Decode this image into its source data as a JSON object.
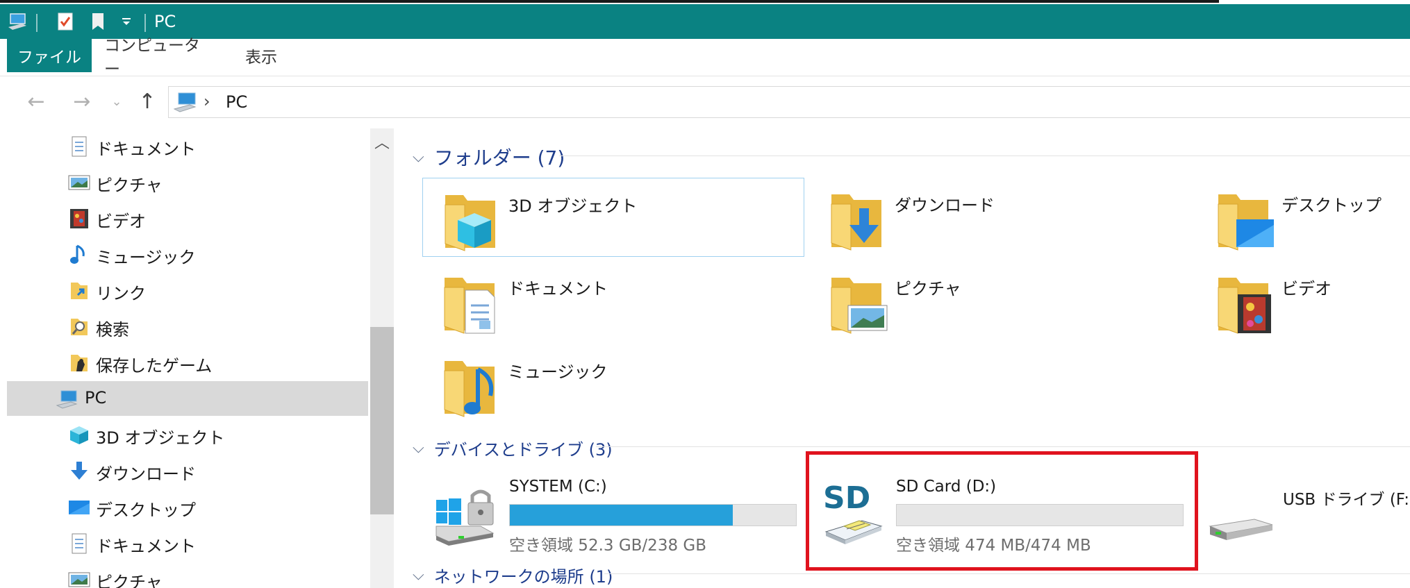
{
  "window": {
    "title": "PC",
    "accent_color": "#0a8282"
  },
  "ribbon": {
    "tabs": [
      {
        "label": "ファイル",
        "active": true
      },
      {
        "label": "コンピューター",
        "active": false
      },
      {
        "label": "表示",
        "active": false
      }
    ]
  },
  "address": {
    "breadcrumb": [
      "PC"
    ]
  },
  "nav_pane": {
    "items": [
      {
        "label": "ドキュメント",
        "icon": "document-icon"
      },
      {
        "label": "ピクチャ",
        "icon": "pictures-icon"
      },
      {
        "label": "ビデオ",
        "icon": "video-icon"
      },
      {
        "label": "ミュージック",
        "icon": "music-icon"
      },
      {
        "label": "リンク",
        "icon": "links-icon"
      },
      {
        "label": "検索",
        "icon": "search-folder-icon"
      },
      {
        "label": "保存したゲーム",
        "icon": "saved-games-icon"
      },
      {
        "label": "PC",
        "icon": "computer-icon",
        "selected": true
      },
      {
        "label": "3D オブジェクト",
        "icon": "3d-objects-icon"
      },
      {
        "label": "ダウンロード",
        "icon": "download-icon"
      },
      {
        "label": "デスクトップ",
        "icon": "desktop-icon"
      },
      {
        "label": "ドキュメント",
        "icon": "document-icon"
      },
      {
        "label": "ピクチャ",
        "icon": "pictures-icon"
      }
    ]
  },
  "content": {
    "folders_group": {
      "title": "フォルダー (7)",
      "items": [
        {
          "label": "3D オブジェクト",
          "icon": "3d-objects-folder-icon",
          "selected": true
        },
        {
          "label": "ダウンロード",
          "icon": "downloads-folder-icon"
        },
        {
          "label": "デスクトップ",
          "icon": "desktop-folder-icon"
        },
        {
          "label": "ドキュメント",
          "icon": "documents-folder-icon"
        },
        {
          "label": "ピクチャ",
          "icon": "pictures-folder-icon"
        },
        {
          "label": "ビデオ",
          "icon": "videos-folder-icon"
        },
        {
          "label": "ミュージック",
          "icon": "music-folder-icon"
        }
      ]
    },
    "devices_group": {
      "title": "デバイスとドライブ (3)",
      "drives": [
        {
          "label": "SYSTEM (C:)",
          "icon": "system-drive-icon",
          "free_text": "空き領域 52.3 GB/238 GB",
          "used_fraction": 0.78,
          "bar_color": "#26a0da"
        },
        {
          "label": "SD Card (D:)",
          "icon": "sd-card-icon",
          "free_text": "空き領域 474 MB/474 MB",
          "used_fraction": 0.0,
          "highlight_color": "#e0131e"
        },
        {
          "label": "USB ドライブ (F:)",
          "icon": "usb-drive-icon"
        }
      ],
      "sd_badge_text": "SD"
    },
    "network_group": {
      "title": "ネットワークの場所 (1)"
    }
  }
}
